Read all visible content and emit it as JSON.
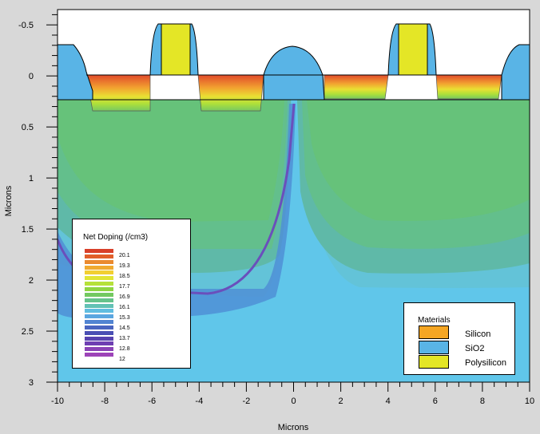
{
  "chart_data": {
    "type": "heatmap",
    "title": "",
    "xlabel": "Microns",
    "ylabel": "Microns",
    "xlim": [
      -10,
      10
    ],
    "ylim": [
      -0.65,
      3
    ],
    "y_inverted": true,
    "x_ticks": [
      "-10",
      "-8",
      "-6",
      "-4",
      "-2",
      "0",
      "2",
      "4",
      "6",
      "8",
      "10"
    ],
    "y_ticks": [
      "-0.5",
      "0",
      "0.5",
      "1",
      "1.5",
      "2",
      "2.5",
      "3"
    ],
    "doping_legend": {
      "title": "Net Doping (/cm3)",
      "labels": [
        "20.1",
        "19.3",
        "18.5",
        "17.7",
        "16.9",
        "16.1",
        "15.3",
        "14.5",
        "13.7",
        "12.8",
        "12"
      ],
      "colors": [
        "#d8402a",
        "#e15f2b",
        "#ea8a2f",
        "#f0aa30",
        "#f2cf31",
        "#e1e534",
        "#b6e13a",
        "#8fd542",
        "#73c960",
        "#66c28b",
        "#62c1b4",
        "#60bde0",
        "#5aa6e0",
        "#5184d2",
        "#4a65c0",
        "#4a4fb4",
        "#5742b0",
        "#6e3fb2",
        "#8a42b6",
        "#9d44b8"
      ]
    },
    "materials_legend": {
      "title": "Materials",
      "items": [
        {
          "label": "Silicon",
          "color": "#f5a623"
        },
        {
          "label": "SiO2",
          "color": "#59b4e6"
        },
        {
          "label": "Polysilicon",
          "color": "#e4e626"
        }
      ]
    },
    "regions": {
      "oxide_surface_y": 0.25,
      "gate_x_centers": [
        -5,
        5
      ],
      "source_drain_x": [
        [
          -8.7,
          -6
        ],
        [
          -4,
          -1.3
        ],
        [
          1.3,
          4
        ],
        [
          6,
          8.7
        ]
      ],
      "junction_depth_y": 2.1
    }
  }
}
